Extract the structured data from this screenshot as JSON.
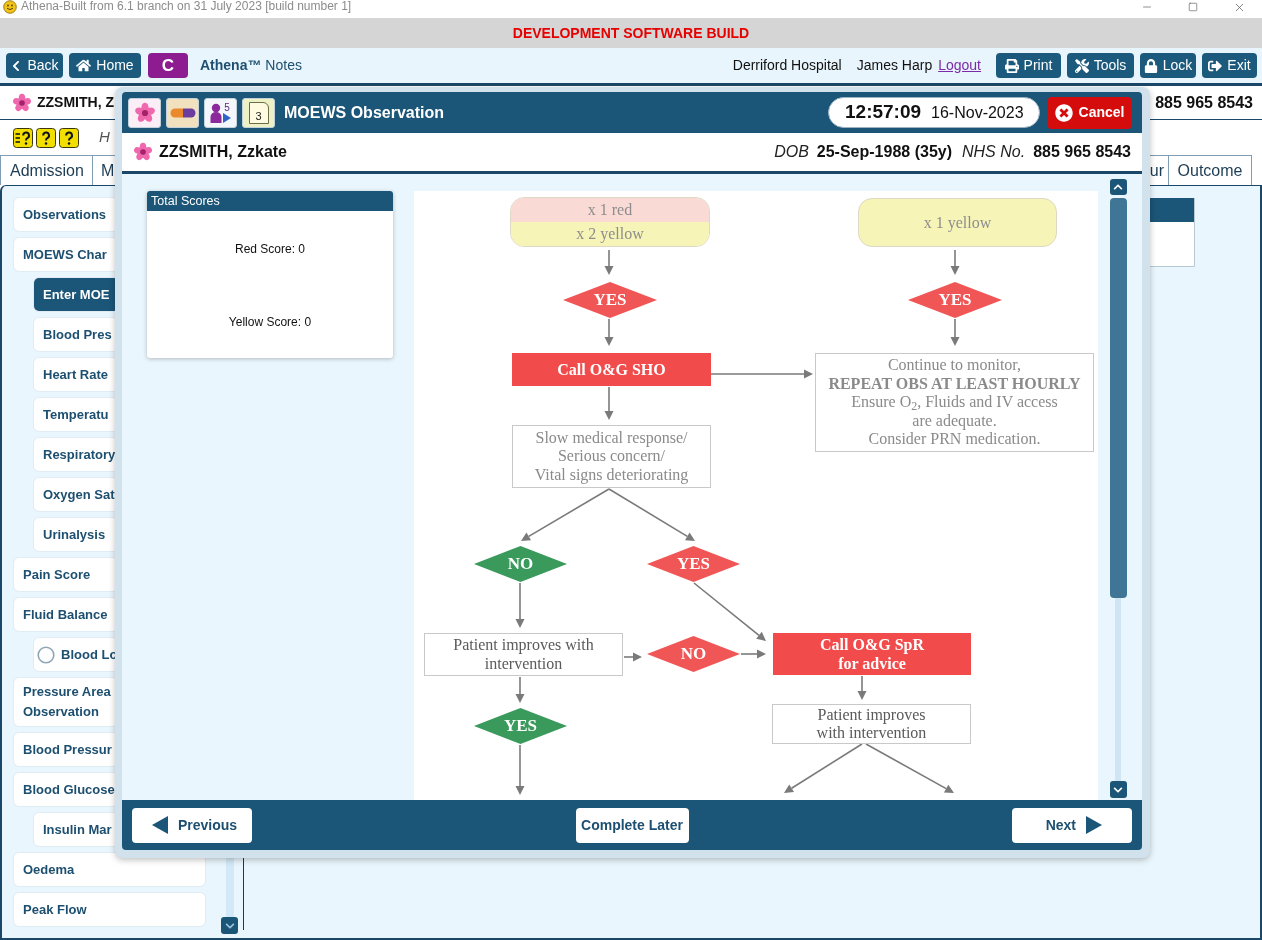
{
  "window": {
    "title": "Athena-Built from 6.1 branch on 31 July 2023 [build number 1]"
  },
  "banner": {
    "text": "DEVELOPMENT SOFTWARE BUILD"
  },
  "toolbar": {
    "nav_buttons": [
      {
        "kind": "back",
        "label": "Back"
      },
      {
        "kind": "home",
        "label": "Home"
      },
      {
        "kind": "letter",
        "label": "C"
      }
    ],
    "app_title": "**Athena™** Notes",
    "location": "Derriford Hospital",
    "user": "James Harp",
    "logout": "Logout",
    "action_buttons": [
      {
        "kind": "print",
        "label": "Print"
      },
      {
        "kind": "tools",
        "label": "Tools"
      },
      {
        "kind": "lock",
        "label": "Lock"
      },
      {
        "kind": "exit",
        "label": "Exit"
      }
    ]
  },
  "patient_bar": {
    "name": "ZZSMITH, Z",
    "nhs_number": "885 965 8543"
  },
  "info_row": {
    "alert_icons": [
      {
        "kind": "list-help"
      },
      {
        "kind": "help"
      },
      {
        "kind": "help"
      }
    ],
    "text": "H"
  },
  "tabs": [
    {
      "label": "Admission",
      "selected": false
    },
    {
      "label": "M",
      "selected": false
    },
    {
      "label": "ur",
      "selected": false
    },
    {
      "label": "Outcome",
      "selected": false
    }
  ],
  "sidebar": {
    "items": [
      {
        "label": "Observations",
        "selected": false
      },
      {
        "label": "MOEWS Char",
        "selected": false,
        "children": [
          {
            "label": "Enter MOE",
            "selected": true
          },
          {
            "label": "Blood Pres",
            "selected": false
          },
          {
            "label": "Heart Rate",
            "selected": false
          },
          {
            "label": "Temperatu",
            "selected": false
          },
          {
            "label": "Respiratory",
            "selected": false
          },
          {
            "label": "Oxygen Sat",
            "selected": false
          },
          {
            "label": "Urinalysis",
            "selected": false
          }
        ]
      },
      {
        "label": "Pain Score",
        "selected": false
      },
      {
        "label": "Fluid Balance",
        "selected": false,
        "children": [
          {
            "label": "Blood Lo",
            "selected": false,
            "kind": "radio",
            "checked": false
          }
        ]
      },
      {
        "label": "Pressure Area\nObservation",
        "selected": false
      },
      {
        "label": "Blood Pressur",
        "selected": false
      },
      {
        "label": "Blood Glucose",
        "selected": false,
        "children": [
          {
            "label": "Insulin Mar",
            "selected": false
          }
        ]
      },
      {
        "label": "Oedema",
        "selected": false
      },
      {
        "label": "Peak Flow",
        "selected": false
      }
    ]
  },
  "modal": {
    "header_icons": [
      {
        "kind": "flower"
      },
      {
        "kind": "pill"
      },
      {
        "kind": "people",
        "badge": "5"
      },
      {
        "kind": "note",
        "badge": "3"
      }
    ],
    "title": "MOEWS Observation",
    "time": "12:57:09",
    "date": "16-Nov-2023",
    "cancel": "Cancel",
    "patient": {
      "name": "ZZSMITH, Zzkate",
      "dob_label": "DOB",
      "dob": "25-Sep-1988 (35y)",
      "nhs_label": "NHS No.",
      "nhs_number": "885 965 8543"
    },
    "scores": {
      "title": "Total Scores",
      "lines": [
        "Red Score: 0",
        "Yellow Score: 0"
      ]
    },
    "flowchart": {
      "nodes": [
        {
          "kind": "split",
          "parts": [
            {
              "text": "x 1 red",
              "color": "#f9dad5"
            },
            {
              "text": "x 2 yellow",
              "color": "#f7f4b8"
            }
          ]
        },
        {
          "kind": "rounded",
          "color": "#f7f4b8",
          "lines": [
            "x 1 yellow"
          ]
        },
        {
          "kind": "decision",
          "color": "#f05656",
          "lines": [
            "YES"
          ]
        },
        {
          "kind": "decision",
          "color": "#f05656",
          "lines": [
            "YES"
          ]
        },
        {
          "kind": "action",
          "color": "#f24b4b",
          "lines": [
            "Call O&G SHO"
          ]
        },
        {
          "kind": "box",
          "lines": [
            "Continue to monitor,",
            "**REPEAT OBS AT LEAST HOURLY**",
            "Ensure O$_{2}$, Fluids and IV access",
            "are adequate.",
            "Consider PRN medication."
          ]
        },
        {
          "kind": "box",
          "lines": [
            "Slow medical response/",
            "Serious concern/",
            "Vital signs deteriorating"
          ]
        },
        {
          "kind": "decision",
          "color": "#3a9a5c",
          "lines": [
            "NO"
          ]
        },
        {
          "kind": "decision",
          "color": "#f05656",
          "lines": [
            "YES"
          ]
        },
        {
          "kind": "box",
          "lines": [
            "Patient improves with",
            "intervention"
          ]
        },
        {
          "kind": "decision",
          "color": "#f05656",
          "lines": [
            "NO"
          ]
        },
        {
          "kind": "action",
          "color": "#f24b4b",
          "lines": [
            "Call O&G SpR",
            "for advice"
          ]
        },
        {
          "kind": "decision",
          "color": "#3a9a5c",
          "lines": [
            "YES"
          ]
        },
        {
          "kind": "box",
          "lines": [
            "Patient improves",
            "with intervention"
          ]
        }
      ]
    },
    "footer": {
      "previous": "Previous",
      "complete_later": "Complete Later",
      "next": "Next"
    }
  }
}
